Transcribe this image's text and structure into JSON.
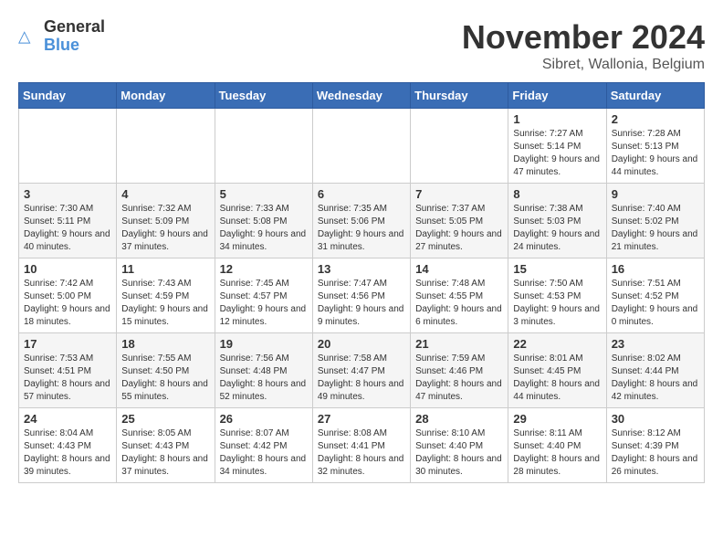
{
  "header": {
    "logo_general": "General",
    "logo_blue": "Blue",
    "month_title": "November 2024",
    "subtitle": "Sibret, Wallonia, Belgium"
  },
  "days_of_week": [
    "Sunday",
    "Monday",
    "Tuesday",
    "Wednesday",
    "Thursday",
    "Friday",
    "Saturday"
  ],
  "weeks": [
    [
      {
        "day": "",
        "info": ""
      },
      {
        "day": "",
        "info": ""
      },
      {
        "day": "",
        "info": ""
      },
      {
        "day": "",
        "info": ""
      },
      {
        "day": "",
        "info": ""
      },
      {
        "day": "1",
        "info": "Sunrise: 7:27 AM\nSunset: 5:14 PM\nDaylight: 9 hours and 47 minutes."
      },
      {
        "day": "2",
        "info": "Sunrise: 7:28 AM\nSunset: 5:13 PM\nDaylight: 9 hours and 44 minutes."
      }
    ],
    [
      {
        "day": "3",
        "info": "Sunrise: 7:30 AM\nSunset: 5:11 PM\nDaylight: 9 hours and 40 minutes."
      },
      {
        "day": "4",
        "info": "Sunrise: 7:32 AM\nSunset: 5:09 PM\nDaylight: 9 hours and 37 minutes."
      },
      {
        "day": "5",
        "info": "Sunrise: 7:33 AM\nSunset: 5:08 PM\nDaylight: 9 hours and 34 minutes."
      },
      {
        "day": "6",
        "info": "Sunrise: 7:35 AM\nSunset: 5:06 PM\nDaylight: 9 hours and 31 minutes."
      },
      {
        "day": "7",
        "info": "Sunrise: 7:37 AM\nSunset: 5:05 PM\nDaylight: 9 hours and 27 minutes."
      },
      {
        "day": "8",
        "info": "Sunrise: 7:38 AM\nSunset: 5:03 PM\nDaylight: 9 hours and 24 minutes."
      },
      {
        "day": "9",
        "info": "Sunrise: 7:40 AM\nSunset: 5:02 PM\nDaylight: 9 hours and 21 minutes."
      }
    ],
    [
      {
        "day": "10",
        "info": "Sunrise: 7:42 AM\nSunset: 5:00 PM\nDaylight: 9 hours and 18 minutes."
      },
      {
        "day": "11",
        "info": "Sunrise: 7:43 AM\nSunset: 4:59 PM\nDaylight: 9 hours and 15 minutes."
      },
      {
        "day": "12",
        "info": "Sunrise: 7:45 AM\nSunset: 4:57 PM\nDaylight: 9 hours and 12 minutes."
      },
      {
        "day": "13",
        "info": "Sunrise: 7:47 AM\nSunset: 4:56 PM\nDaylight: 9 hours and 9 minutes."
      },
      {
        "day": "14",
        "info": "Sunrise: 7:48 AM\nSunset: 4:55 PM\nDaylight: 9 hours and 6 minutes."
      },
      {
        "day": "15",
        "info": "Sunrise: 7:50 AM\nSunset: 4:53 PM\nDaylight: 9 hours and 3 minutes."
      },
      {
        "day": "16",
        "info": "Sunrise: 7:51 AM\nSunset: 4:52 PM\nDaylight: 9 hours and 0 minutes."
      }
    ],
    [
      {
        "day": "17",
        "info": "Sunrise: 7:53 AM\nSunset: 4:51 PM\nDaylight: 8 hours and 57 minutes."
      },
      {
        "day": "18",
        "info": "Sunrise: 7:55 AM\nSunset: 4:50 PM\nDaylight: 8 hours and 55 minutes."
      },
      {
        "day": "19",
        "info": "Sunrise: 7:56 AM\nSunset: 4:48 PM\nDaylight: 8 hours and 52 minutes."
      },
      {
        "day": "20",
        "info": "Sunrise: 7:58 AM\nSunset: 4:47 PM\nDaylight: 8 hours and 49 minutes."
      },
      {
        "day": "21",
        "info": "Sunrise: 7:59 AM\nSunset: 4:46 PM\nDaylight: 8 hours and 47 minutes."
      },
      {
        "day": "22",
        "info": "Sunrise: 8:01 AM\nSunset: 4:45 PM\nDaylight: 8 hours and 44 minutes."
      },
      {
        "day": "23",
        "info": "Sunrise: 8:02 AM\nSunset: 4:44 PM\nDaylight: 8 hours and 42 minutes."
      }
    ],
    [
      {
        "day": "24",
        "info": "Sunrise: 8:04 AM\nSunset: 4:43 PM\nDaylight: 8 hours and 39 minutes."
      },
      {
        "day": "25",
        "info": "Sunrise: 8:05 AM\nSunset: 4:43 PM\nDaylight: 8 hours and 37 minutes."
      },
      {
        "day": "26",
        "info": "Sunrise: 8:07 AM\nSunset: 4:42 PM\nDaylight: 8 hours and 34 minutes."
      },
      {
        "day": "27",
        "info": "Sunrise: 8:08 AM\nSunset: 4:41 PM\nDaylight: 8 hours and 32 minutes."
      },
      {
        "day": "28",
        "info": "Sunrise: 8:10 AM\nSunset: 4:40 PM\nDaylight: 8 hours and 30 minutes."
      },
      {
        "day": "29",
        "info": "Sunrise: 8:11 AM\nSunset: 4:40 PM\nDaylight: 8 hours and 28 minutes."
      },
      {
        "day": "30",
        "info": "Sunrise: 8:12 AM\nSunset: 4:39 PM\nDaylight: 8 hours and 26 minutes."
      }
    ]
  ]
}
